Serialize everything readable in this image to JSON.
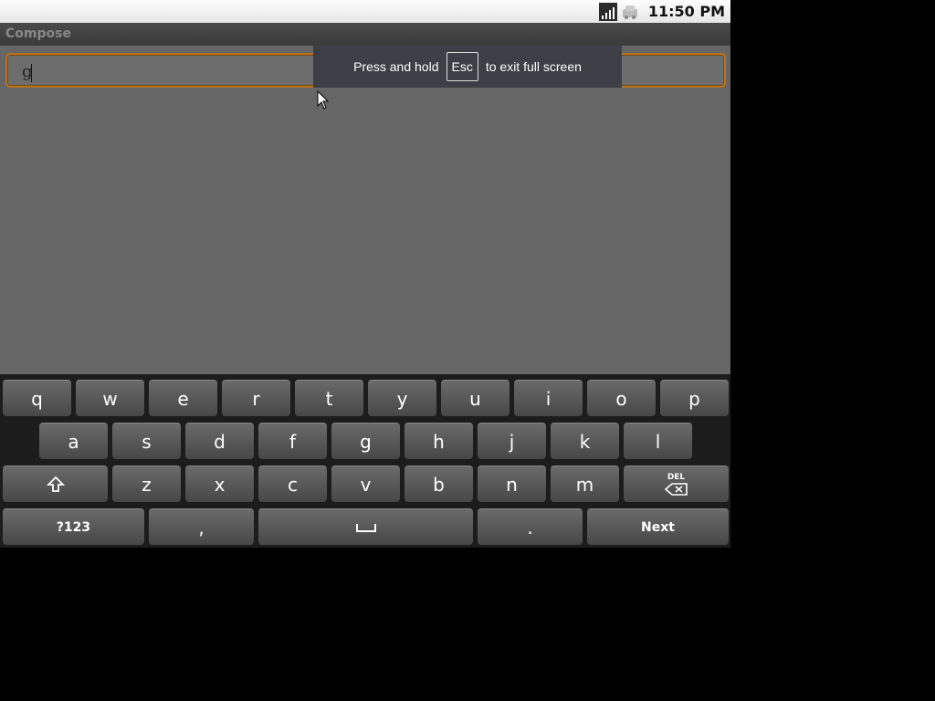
{
  "status_bar": {
    "time": "11:50 PM"
  },
  "title_bar": {
    "title": "Compose"
  },
  "compose": {
    "value": "g"
  },
  "toast": {
    "prefix": "Press and hold",
    "key": "Esc",
    "suffix": "to exit full screen"
  },
  "keyboard": {
    "row1": [
      "q",
      "w",
      "e",
      "r",
      "t",
      "y",
      "u",
      "i",
      "o",
      "p"
    ],
    "row2": [
      "a",
      "s",
      "d",
      "f",
      "g",
      "h",
      "j",
      "k",
      "l"
    ],
    "row3": [
      "z",
      "x",
      "c",
      "v",
      "b",
      "n",
      "m"
    ],
    "del_label": "DEL",
    "symbols_label": "?123",
    "comma_label": ",",
    "period_label": ".",
    "next_label": "Next"
  }
}
